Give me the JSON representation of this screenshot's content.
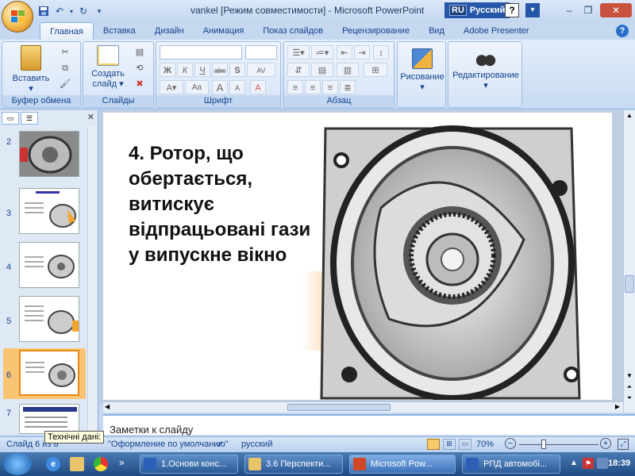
{
  "window": {
    "title": "vankel [Режим совместимости] - Microsoft PowerPoint",
    "lang_code": "RU",
    "lang_name": "Русский",
    "help_glyph": "?"
  },
  "qat": {
    "save_icon": "save-icon",
    "undo_icon": "undo-icon",
    "redo_icon": "redo-icon"
  },
  "tabs": [
    "Главная",
    "Вставка",
    "Дизайн",
    "Анимация",
    "Показ слайдов",
    "Рецензирование",
    "Вид",
    "Adobe Presenter"
  ],
  "ribbon": {
    "clipboard": {
      "label": "Буфер обмена",
      "paste": "Вставить"
    },
    "slides": {
      "label": "Слайды",
      "new_slide": "Создать слайд"
    },
    "font": {
      "label": "Шрифт",
      "bold": "Ж",
      "italic": "К",
      "underline": "Ч",
      "strike": "abc",
      "shadow": "S",
      "spacing": "AV",
      "grow": "A",
      "shrink": "A",
      "case": "Aa",
      "clear": "A"
    },
    "paragraph": {
      "label": "Абзац"
    },
    "drawing": {
      "label": "Рисование"
    },
    "editing": {
      "label": "Редактирование"
    }
  },
  "thumbnails": [
    {
      "num": "2",
      "selected": false
    },
    {
      "num": "3",
      "selected": false
    },
    {
      "num": "4",
      "selected": false
    },
    {
      "num": "5",
      "selected": false
    },
    {
      "num": "6",
      "selected": true
    },
    {
      "num": "7",
      "selected": false
    }
  ],
  "slide": {
    "text": "4. Ротор, що обертається, витискує відпрацьовані гази у випускне вікно"
  },
  "notes": {
    "placeholder": "Заметки к слайду"
  },
  "tooltip": "Технічні дані:",
  "status": {
    "slide": "Слайд 6 из 8",
    "theme": "\"Оформление по умолчанию\"",
    "lang": "русский",
    "zoom": "70%"
  },
  "taskbar": {
    "items": [
      "1.Основи конс...",
      "3.6 Перспекти...",
      "Microsoft Pow...",
      "РПД автомобі..."
    ],
    "time": "18:39"
  }
}
